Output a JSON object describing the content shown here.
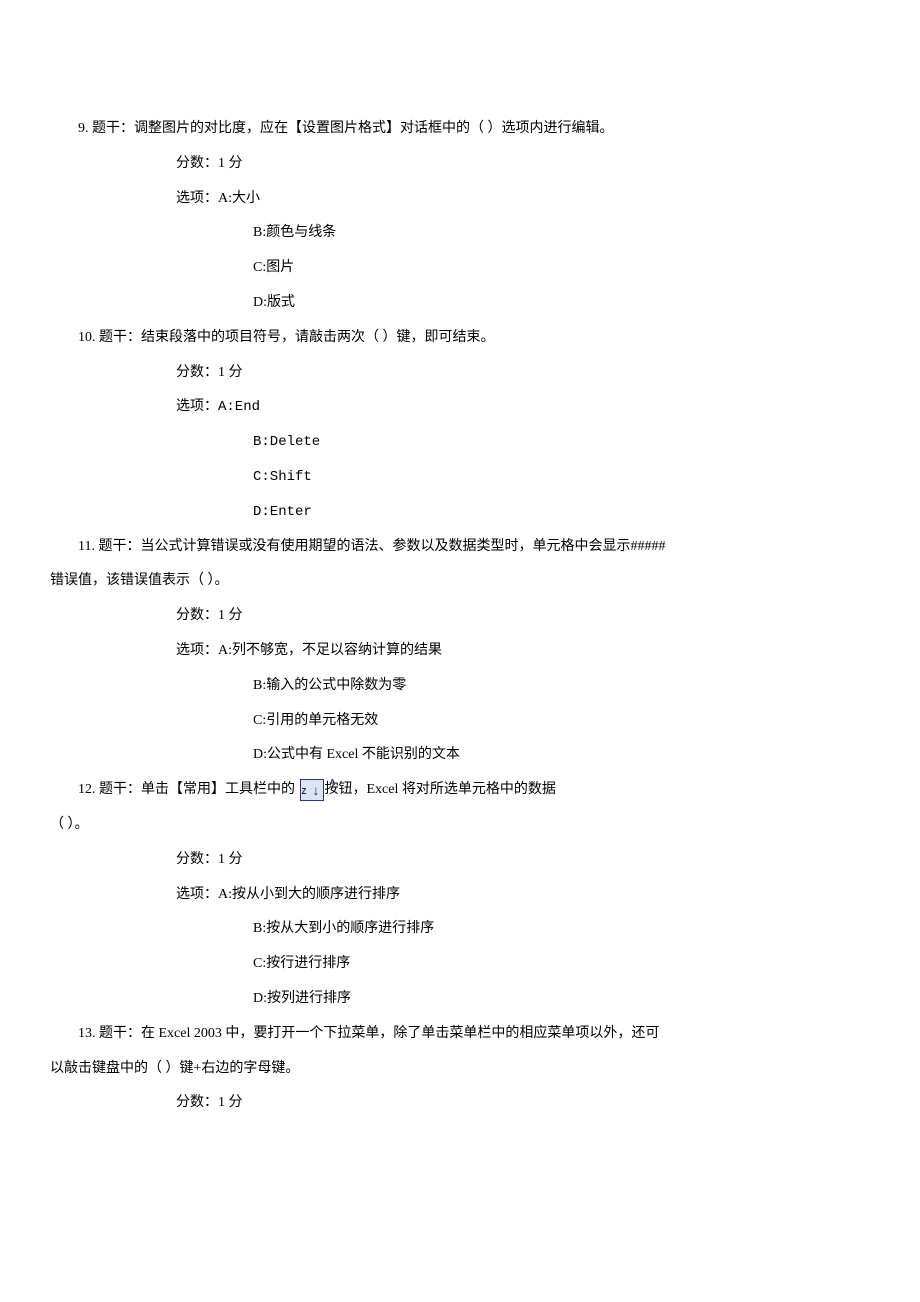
{
  "q9": {
    "num": "9.",
    "label_stem": "题干：",
    "stem": "调整图片的对比度，应在【设置图片格式】对话框中的（      ）选项内进行编辑。",
    "label_score": "分数：",
    "score": "1 分",
    "label_opts": "选项：",
    "a": "A:大小",
    "b": "B:颜色与线条",
    "c": "C:图片",
    "d": "D:版式"
  },
  "q10": {
    "num": "10.",
    "label_stem": "题干：",
    "stem": "结束段落中的项目符号，请敲击两次（      ）键，即可结束。",
    "label_score": "分数：",
    "score": "1 分",
    "label_opts": "选项：",
    "a": "A:End",
    "b": "B:Delete",
    "c": "C:Shift",
    "d": "D:Enter"
  },
  "q11": {
    "num": "11.",
    "label_stem": "题干：",
    "stem1": "当公式计算错误或没有使用期望的语法、参数以及数据类型时，单元格中会显示#####",
    "stem2": "错误值，该错误值表示（             ）。",
    "label_score": "分数：",
    "score": "1 分",
    "label_opts": "选项：",
    "a": "A:列不够宽，不足以容纳计算的结果",
    "b": "B:输入的公式中除数为零",
    "c": "C:引用的单元格无效",
    "d": "D:公式中有 Excel 不能识别的文本"
  },
  "q12": {
    "num": "12.",
    "label_stem": "题干：",
    "stem_pre": "单击【常用】工具栏中的 ",
    "stem_post": "按钮，Excel 将对所选单元格中的数据",
    "stem2": "（             ）。",
    "label_score": "分数：",
    "score": "1 分",
    "label_opts": "选项：",
    "a": "A:按从小到大的顺序进行排序",
    "b": "B:按从大到小的顺序进行排序",
    "c": "C:按行进行排序",
    "d": "D:按列进行排序"
  },
  "q13": {
    "num": "13.",
    "label_stem": "题干：",
    "stem1": "在 Excel 2003 中，要打开一个下拉菜单，除了单击菜单栏中的相应菜单项以外，还可",
    "stem2": "以敲击键盘中的（                ）键+右边的字母键。",
    "label_score": "分数：",
    "score": "1 分"
  }
}
